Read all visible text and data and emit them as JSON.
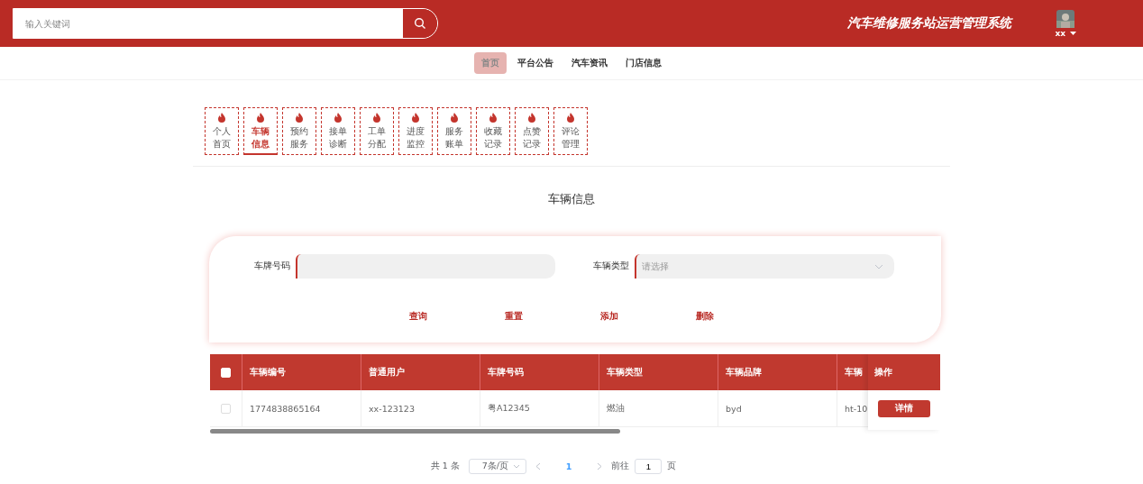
{
  "header": {
    "search": {
      "placeholder": "输入关键词"
    },
    "title": "汽车维修服务站运营管理系统",
    "user": {
      "name": "xx"
    }
  },
  "nav": [
    {
      "label": "首页",
      "selected": true
    },
    {
      "label": "平台公告",
      "selected": false
    },
    {
      "label": "汽车资讯",
      "selected": false
    },
    {
      "label": "门店信息",
      "selected": false
    }
  ],
  "tabs": [
    {
      "label": [
        "个人",
        "首页"
      ],
      "selected": false
    },
    {
      "label": [
        "车辆",
        "信息"
      ],
      "selected": true
    },
    {
      "label": [
        "预约",
        "服务"
      ],
      "selected": false
    },
    {
      "label": [
        "接单",
        "诊断"
      ],
      "selected": false
    },
    {
      "label": [
        "工单",
        "分配"
      ],
      "selected": false
    },
    {
      "label": [
        "进度",
        "监控"
      ],
      "selected": false
    },
    {
      "label": [
        "服务",
        "账单"
      ],
      "selected": false
    },
    {
      "label": [
        "收藏",
        "记录"
      ],
      "selected": false
    },
    {
      "label": [
        "点赞",
        "记录"
      ],
      "selected": false
    },
    {
      "label": [
        "评论",
        "管理"
      ],
      "selected": false
    }
  ],
  "page_title": "车辆信息",
  "filters": [
    {
      "label": "车牌号码",
      "kind": "input"
    },
    {
      "label": "车辆类型",
      "kind": "select",
      "placeholder": "请选择"
    }
  ],
  "actions": [
    "查询",
    "重置",
    "添加",
    "删除"
  ],
  "table": {
    "all_checked": false,
    "columns": [
      "车辆编号",
      "普通用户",
      "车牌号码",
      "车辆类型",
      "车辆品牌",
      "车辆"
    ],
    "action_column": "操作",
    "rows": [
      {
        "checked": false,
        "cells": [
          "1774838865164",
          "xx-123123",
          "粤A12345",
          "燃油",
          "byd",
          "ht-10"
        ],
        "action": "详情"
      }
    ]
  },
  "pagination": {
    "total": "共 1 条",
    "page_size": "7条/页",
    "pages": [
      {
        "label": "1",
        "selected": true
      }
    ],
    "goto_label": "前往",
    "goto_value": "1",
    "goto_suffix": "页"
  }
}
